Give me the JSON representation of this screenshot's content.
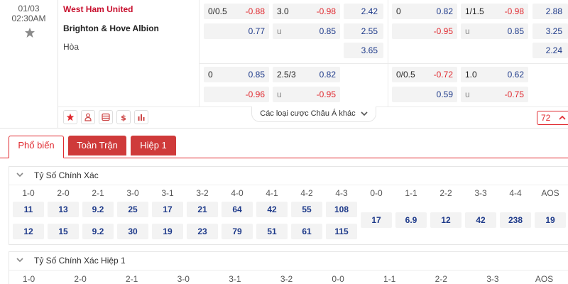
{
  "match": {
    "date": "01/03",
    "time": "02:30AM",
    "home": "West Ham United",
    "away": "Brighton & Hove Albion",
    "draw": "Hòa",
    "ft": {
      "hdp_line": "0/0.5",
      "hdp_home": "-0.88",
      "hdp_away": "0.77",
      "ou_line": "3.0",
      "ou_over": "-0.98",
      "ou_under_label": "u",
      "ou_under": "0.85",
      "x12_home": "2.42",
      "x12_away": "2.55",
      "x12_draw": "3.65"
    },
    "fh": {
      "hdp_line": "0",
      "hdp_home": "0.82",
      "hdp_away": "-0.95",
      "ou_line": "1/1.5",
      "ou_over": "-0.98",
      "ou_under_label": "u",
      "ou_under": "0.85",
      "x12_home": "2.88",
      "x12_away": "3.25",
      "x12_draw": "2.24"
    },
    "ft_alt": {
      "hdp_line": "0",
      "hdp_home": "0.85",
      "hdp_away": "-0.96",
      "ou_line": "2.5/3",
      "ou_over": "0.82",
      "ou_under_label": "u",
      "ou_under": "-0.95"
    },
    "fh_alt": {
      "hdp_line": "0/0.5",
      "hdp_home": "-0.72",
      "hdp_away": "0.59",
      "ou_line": "1.0",
      "ou_over": "0.62",
      "ou_under_label": "u",
      "ou_under": "-0.75"
    },
    "more_bets_label": "Các loại cược Châu Á khác",
    "more_count": "72"
  },
  "tabs": [
    "Phổ biến",
    "Toàn Trận",
    "Hiệp 1"
  ],
  "exact_score": {
    "title": "Tỷ Số Chính Xác",
    "left_headers": [
      "1-0",
      "2-0",
      "2-1",
      "3-0",
      "3-1",
      "3-2",
      "4-0",
      "4-1",
      "4-2",
      "4-3"
    ],
    "row1": [
      "11",
      "13",
      "9.2",
      "25",
      "17",
      "21",
      "64",
      "42",
      "55",
      "108"
    ],
    "row2": [
      "12",
      "15",
      "9.2",
      "30",
      "19",
      "23",
      "79",
      "51",
      "61",
      "115"
    ],
    "right_headers": [
      "0-0",
      "1-1",
      "2-2",
      "3-3",
      "4-4",
      "AOS"
    ],
    "right_values": [
      "17",
      "6.9",
      "12",
      "42",
      "238",
      "19"
    ]
  },
  "exact_score_fh": {
    "title": "Tỷ Số Chính Xác Hiệp 1",
    "headers": [
      "1-0",
      "2-0",
      "2-1",
      "3-0",
      "3-1",
      "3-2",
      "0-0",
      "1-1",
      "2-2",
      "3-3",
      "AOS"
    ]
  },
  "colors": {
    "accent": "#e0282e",
    "tab_red": "#cf3a3a",
    "odds_blue": "#1e3a8a"
  }
}
